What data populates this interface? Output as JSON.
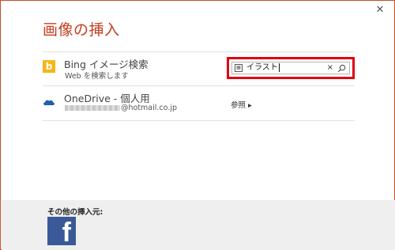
{
  "dialog": {
    "title": "画像の挿入",
    "close_glyph": "✕"
  },
  "sources": {
    "bing": {
      "name": "Bing イメージ検索",
      "sub": "Web を検索します",
      "logo_glyph": "b",
      "search": {
        "value": "イラスト",
        "clear_glyph": "×"
      }
    },
    "onedrive": {
      "name": "OneDrive - 個人用",
      "email_domain": "@hotmail.co.jp",
      "browse_label": "参照 ▸"
    }
  },
  "footer": {
    "label": "その他の挿入元:",
    "facebook_glyph": "f"
  },
  "colors": {
    "title": "#c4401f",
    "highlight": "#e10010",
    "bing": "#f5b619",
    "onedrive": "#1e5fb4",
    "facebook": "#3b5998"
  }
}
